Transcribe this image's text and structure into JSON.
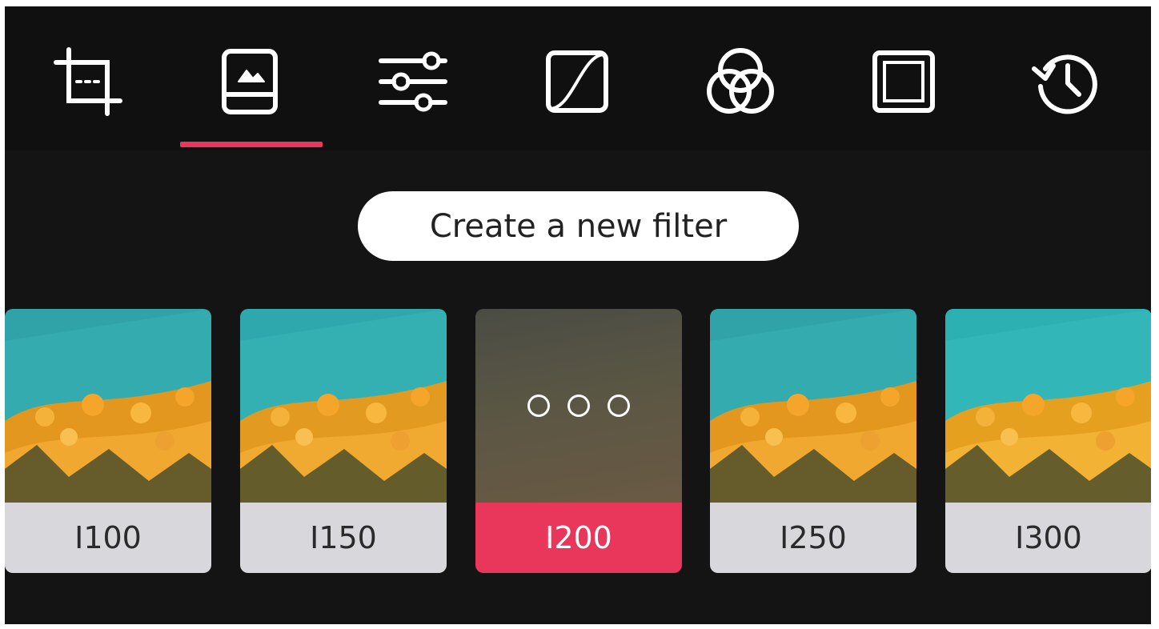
{
  "toolbar": {
    "icons": [
      "crop-icon",
      "filters-icon",
      "adjust-sliders-icon",
      "curves-icon",
      "color-mix-icon",
      "frame-icon",
      "history-icon"
    ],
    "active_index": 1,
    "accent_color": "#e8375a"
  },
  "create_filter": {
    "label": "Create a new filter"
  },
  "filters": [
    {
      "label": "I100",
      "state": "normal"
    },
    {
      "label": "I150",
      "state": "normal"
    },
    {
      "label": "I200",
      "state": "active"
    },
    {
      "label": "I250",
      "state": "normal"
    },
    {
      "label": "I300",
      "state": "normal"
    }
  ],
  "colors": {
    "background": "#141414",
    "label_background": "#d8d7dc",
    "active_label_background": "#e8375a"
  }
}
